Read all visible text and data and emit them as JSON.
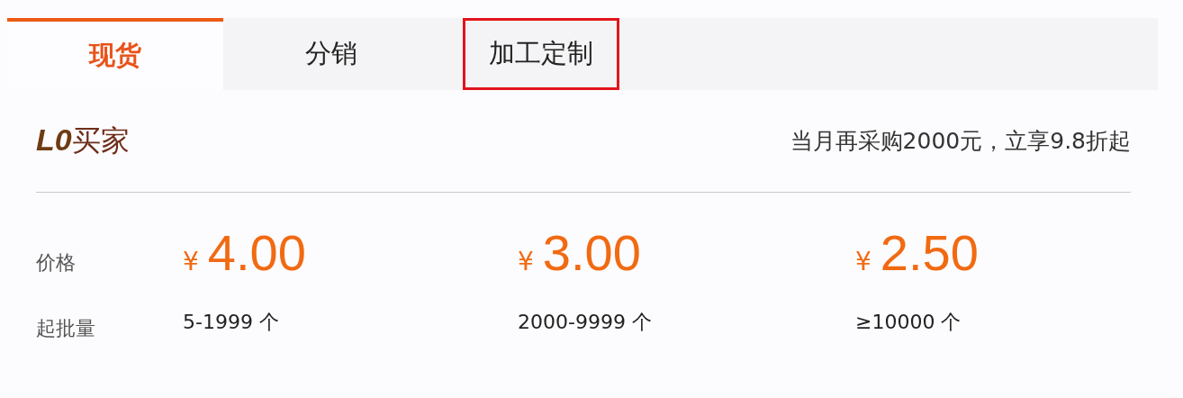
{
  "tabs": [
    {
      "label": "现货",
      "selected": true,
      "highlighted": false
    },
    {
      "label": "分销",
      "selected": false,
      "highlighted": false
    },
    {
      "label": "加工定制",
      "selected": false,
      "highlighted": true
    }
  ],
  "buyer_level": {
    "level_code": "L0",
    "title": "买家",
    "promotion": "当月再采购2000元，立享9.8折起"
  },
  "price_label": "价格",
  "quantity_label": "起批量",
  "tiers": [
    {
      "currency": "¥",
      "price": "4.00",
      "quantity": "5-1999 个"
    },
    {
      "currency": "¥",
      "price": "3.00",
      "quantity": "2000-9999 个"
    },
    {
      "currency": "¥",
      "price": "2.50",
      "quantity": "≥10000 个"
    }
  ]
}
